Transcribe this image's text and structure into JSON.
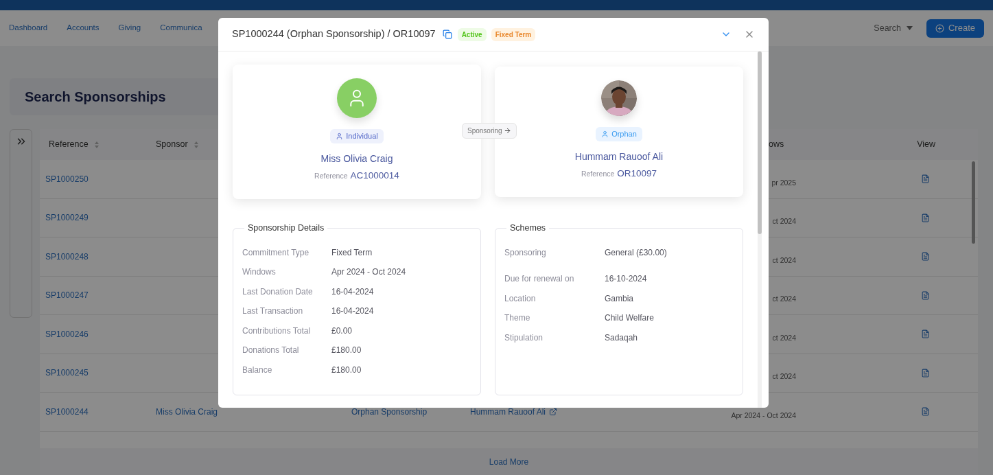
{
  "top_nav": {
    "items": [
      {
        "label": "Dashboard"
      },
      {
        "label": "Accounts"
      },
      {
        "label": "Giving"
      },
      {
        "label": "Communica"
      }
    ]
  },
  "search_menu": {
    "label": "Search"
  },
  "create_button": {
    "label": "Create"
  },
  "page_title": "Search Sponsorships",
  "table": {
    "columns": [
      {
        "label": "Reference",
        "sortable": true
      },
      {
        "label": "Sponsor",
        "sortable": true
      },
      {
        "label": "ows",
        "sortable": false
      },
      {
        "label": "View",
        "sortable": false
      }
    ],
    "rows": [
      {
        "reference": "SP1000250",
        "windows": "pr 2025"
      },
      {
        "reference": "SP1000249",
        "windows": "ct 2024"
      },
      {
        "reference": "SP1000248",
        "windows": "ct 2024"
      },
      {
        "reference": "SP1000247",
        "windows": "ct 2024"
      },
      {
        "reference": "SP1000246",
        "windows": "ct 2024"
      },
      {
        "reference": "SP1000245",
        "windows": "ct 2024"
      },
      {
        "reference": "SP1000244",
        "sponsor": "Miss Olivia Craig",
        "scheme": "Orphan Sponsorship",
        "beneficiary": "Hummam Rauoof Ali",
        "windows": "Apr 2024 - Oct 2024"
      }
    ]
  },
  "load_more": "Load More",
  "modal": {
    "title": "SP1000244 (Orphan Sponsorship) / OR10097",
    "badges": [
      {
        "label": "Active",
        "kind": "success"
      },
      {
        "label": "Fixed Term",
        "kind": "warning"
      }
    ],
    "parties": [
      {
        "kind": "icon",
        "type": "Individual",
        "name": "Miss Olivia Craig",
        "reference_label": "Reference",
        "reference": "AC1000014"
      },
      {
        "type": "Orphan",
        "name": "Hummam Rauoof Ali",
        "reference_label": "Reference",
        "reference": "OR10097"
      }
    ],
    "link_label": "Sponsoring",
    "sections": [
      {
        "title": "Sponsorship Details",
        "rows": [
          {
            "label": "Commitment Type",
            "value": "Fixed Term"
          },
          {
            "label": "Windows",
            "value": "Apr 2024 - Oct 2024"
          },
          {
            "label": "Last Donation Date",
            "value": "16-04-2024"
          },
          {
            "label": "Last Transaction",
            "value": "16-04-2024"
          },
          {
            "label": "Contributions Total",
            "value": "£0.00"
          },
          {
            "label": "Donations Total",
            "value": "£180.00"
          },
          {
            "label": "Balance",
            "value": "£180.00"
          }
        ]
      },
      {
        "title": "Schemes",
        "rows": [
          {
            "label": "Sponsoring",
            "value": "General (£30.00)"
          },
          {
            "label": "Due for renewal on",
            "value": "16-10-2024"
          },
          {
            "label": "Location",
            "value": "Gambia"
          },
          {
            "label": "Theme",
            "value": "Child Welfare"
          },
          {
            "label": "Stipulation",
            "value": "Sadaqah"
          }
        ]
      }
    ]
  }
}
